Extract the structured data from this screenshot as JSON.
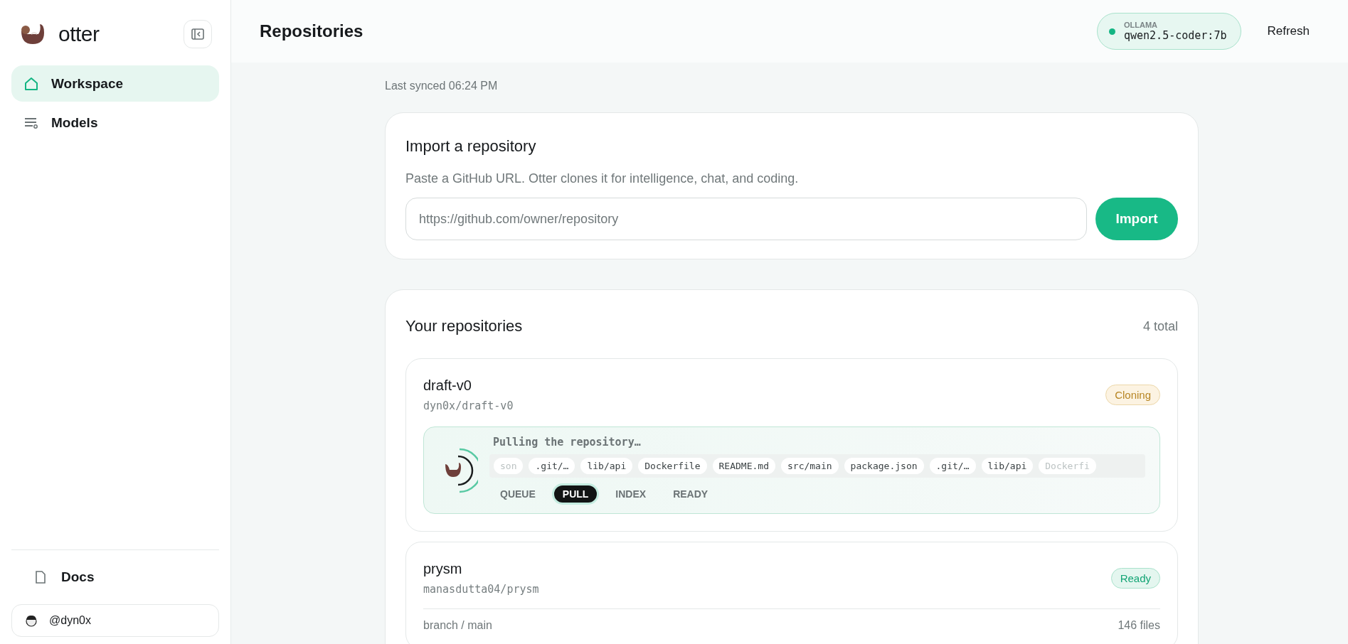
{
  "sidebar": {
    "brand": "otter",
    "nav": [
      {
        "label": "Workspace",
        "kind": "home",
        "selected": true
      },
      {
        "label": "Models",
        "kind": "models",
        "selected": false
      }
    ],
    "docs": "Docs",
    "user": "@dyn0x"
  },
  "header": {
    "title": "Repositories",
    "provider": {
      "label": "OLLAMA",
      "model": "qwen2.5-coder:7b"
    },
    "refresh": "Refresh"
  },
  "last_synced": "Last synced 06:24 PM",
  "import": {
    "title": "Import a repository",
    "description": "Paste a GitHub URL. Otter clones it for intelligence, chat, and coding.",
    "placeholder": "https://github.com/owner/repository",
    "button": "Import"
  },
  "repositories": {
    "title": "Your repositories",
    "count": "4 total",
    "items": [
      {
        "name": "draft-v0",
        "slug": "dyn0x/draft-v0",
        "status": {
          "label": "Cloning",
          "kind": "cloning"
        },
        "progress": {
          "message": "Pulling the repository…",
          "files": [
            "son",
            ".git/…",
            "lib/api",
            "Dockerfile",
            "README.md",
            "src/main",
            "package.json",
            ".git/…",
            "lib/api",
            "Dockerfi"
          ],
          "stages": [
            {
              "label": "QUEUE",
              "selected": false
            },
            {
              "label": "PULL",
              "selected": true
            },
            {
              "label": "INDEX",
              "selected": false
            },
            {
              "label": "READY",
              "selected": false
            }
          ]
        }
      },
      {
        "name": "prysm",
        "slug": "manasdutta04/prysm",
        "status": {
          "label": "Ready",
          "kind": "ready"
        },
        "details": {
          "branch": "branch / main",
          "files": "146 files"
        }
      }
    ]
  }
}
